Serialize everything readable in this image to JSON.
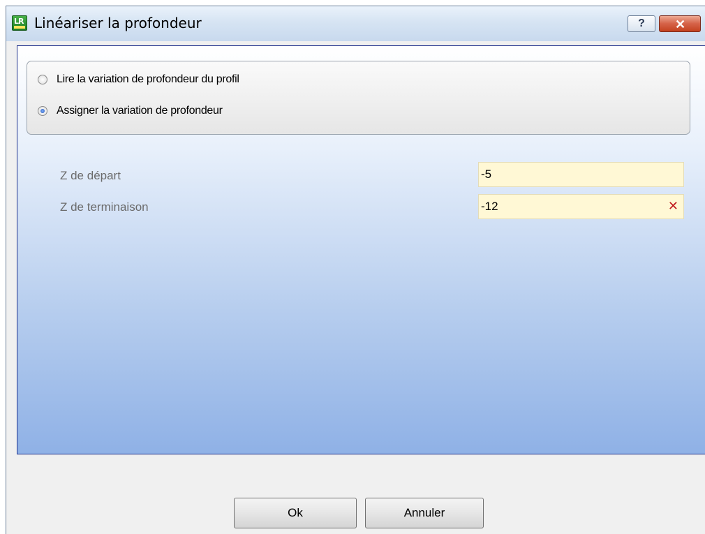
{
  "window": {
    "title": "Linéariser la profondeur"
  },
  "titlebar": {
    "help_label": "?"
  },
  "depth_mode": {
    "options": [
      {
        "label": "Lire la variation de profondeur du profil",
        "checked": false
      },
      {
        "label": "Assigner la variation de profondeur",
        "checked": true
      }
    ]
  },
  "fields": {
    "start_z": {
      "label": "Z de départ",
      "value": "-5"
    },
    "end_z": {
      "label": "Z de terminaison",
      "value": "-12"
    }
  },
  "buttons": {
    "ok": "Ok",
    "cancel": "Annuler"
  },
  "icons": {
    "app": "app-icon",
    "help": "help-icon",
    "close": "close-icon",
    "clear": "clear-icon"
  },
  "colors": {
    "input_background": "#fff8d5",
    "clear_icon": "#c0181c",
    "close_button": "#c4411f"
  }
}
